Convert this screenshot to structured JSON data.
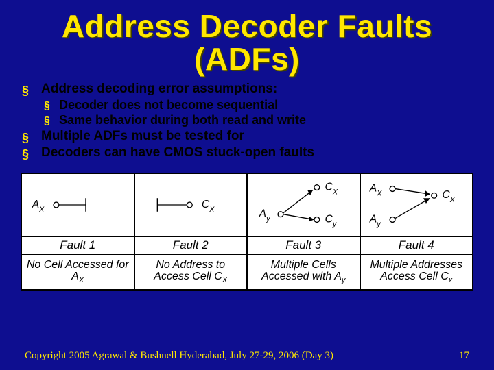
{
  "title_line1": "Address Decoder Faults",
  "title_line2": "(ADFs)",
  "bullets": {
    "b0": "Address decoding error  assumptions:",
    "b0s0": "Decoder does not become sequential",
    "b0s1": "Same behavior during both read and write",
    "b1": "Multiple ADFs must be tested for",
    "b2": "Decoders can have CMOS stuck-open faults"
  },
  "faults": {
    "f1_label": "Fault 1",
    "f2_label": "Fault 2",
    "f3_label": "Fault 3",
    "f4_label": "Fault 4",
    "f1_desc": "No  Cell Accessed for A",
    "f1_sub": "X",
    "f2_desc_a": "No  Address to",
    "f2_desc_b": "Access Cell C",
    "f2_sub": "X",
    "f3_desc_a": "Multiple  Cells",
    "f3_desc_b": "Accessed with A",
    "f3_sub": "y",
    "f4_desc_a": "Multiple Addresses",
    "f4_desc_b": "Access  Cell  C",
    "f4_sub": "x"
  },
  "node": {
    "Ax": "A",
    "Ay": "A",
    "Cx": "C",
    "Cy": "C",
    "x": "X",
    "y": "y"
  },
  "footer": {
    "left": "Copyright 2005 Agrawal & Bushnell   Hyderabad, July 27-29, 2006 (Day 3)",
    "right": "17"
  }
}
